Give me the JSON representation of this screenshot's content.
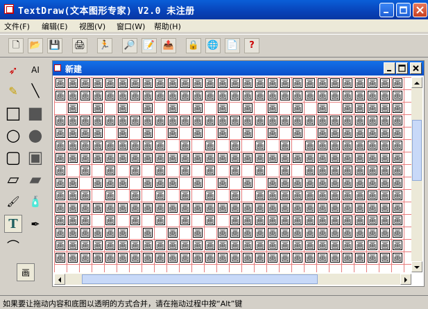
{
  "app": {
    "title": "TextDraw(文本图形专家) V2.0 未注册"
  },
  "menu": [
    "文件(F)",
    "编辑(E)",
    "视图(V)",
    "窗口(W)",
    "帮助(H)"
  ],
  "toolbar": {
    "buttons": [
      {
        "name": "new-icon",
        "glyph": "🗋"
      },
      {
        "name": "open-icon",
        "glyph": "📂"
      },
      {
        "name": "save-icon",
        "glyph": "💾"
      },
      {
        "name": "print-icon",
        "glyph": "🖨"
      },
      {
        "name": "run-icon",
        "glyph": "🏃"
      },
      {
        "name": "find-icon",
        "glyph": "🔎"
      },
      {
        "name": "replace-icon",
        "glyph": "📝"
      },
      {
        "name": "export-icon",
        "glyph": "📤"
      },
      {
        "name": "lock-icon",
        "glyph": "🔒"
      },
      {
        "name": "globe-icon",
        "glyph": "🌐"
      },
      {
        "name": "document-icon",
        "glyph": "📄"
      },
      {
        "name": "help-icon",
        "glyph": "?"
      }
    ]
  },
  "tools": {
    "pointer_glyph": "➶",
    "ai_label": "AI",
    "pen_glyph": "✎",
    "line_glyph": "╲",
    "rect_glyph": "□",
    "filled_rect_glyph": "■",
    "circle_glyph": "○",
    "filled_circle_glyph": "●",
    "round_rect_glyph": "▢",
    "filled_round_rect_glyph": "▣",
    "para_glyph": "▱",
    "filled_para_glyph": "▰",
    "brush_glyph": "🖌",
    "spray_glyph": "🧴",
    "text_glyph": "T",
    "dropper_glyph": "✒",
    "curve_glyph": "⌒",
    "fill_char": "画"
  },
  "document": {
    "title": "新建",
    "fill_char": "画"
  },
  "status": {
    "text": "如果要让拖动内容和底图以透明的方式合并，请在拖动过程中按“Alt”键"
  },
  "colors": {
    "title_bar": "#0842b8",
    "grid_line": "#e05050"
  }
}
